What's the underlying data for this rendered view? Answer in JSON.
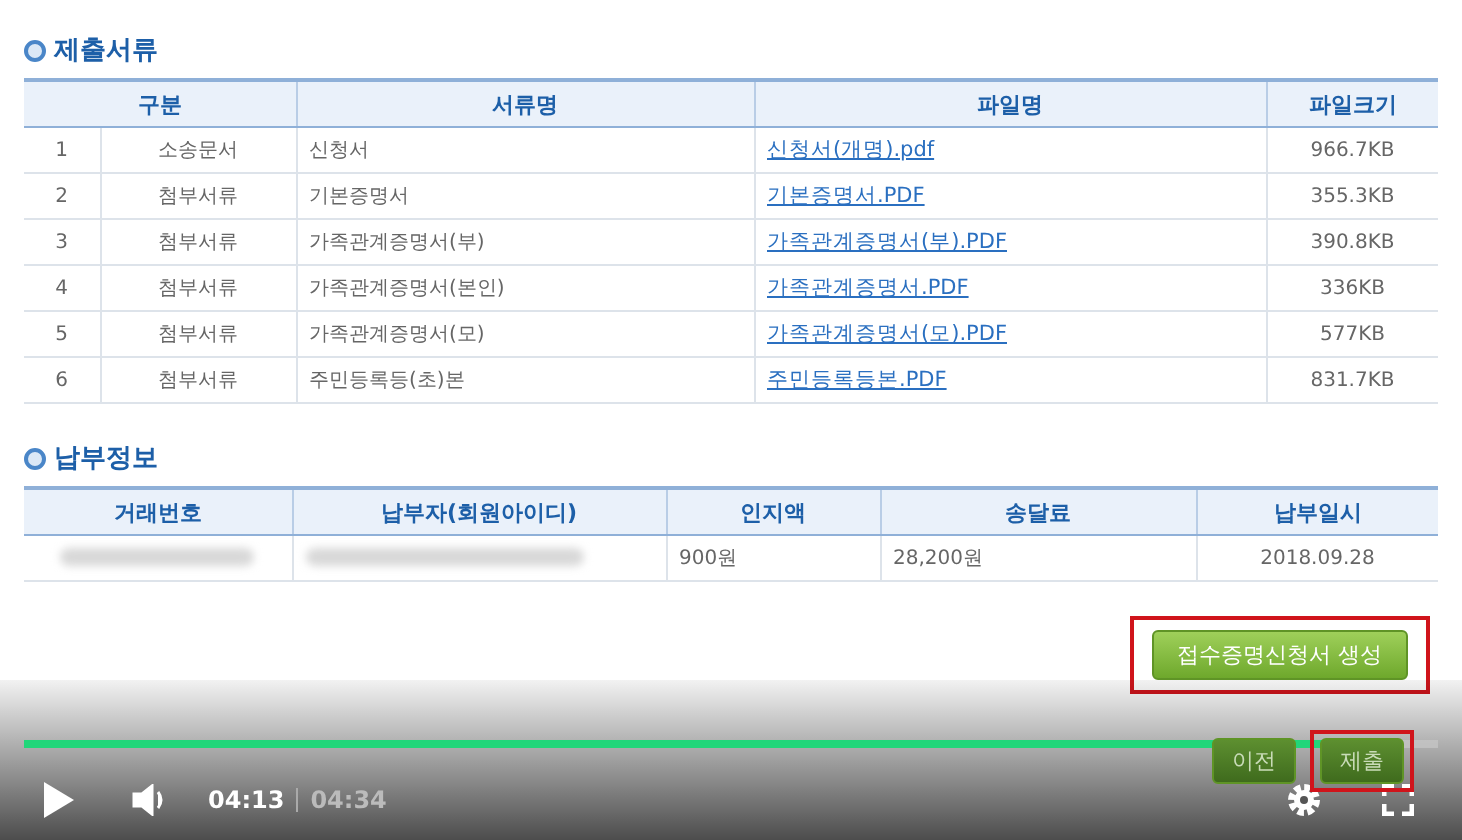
{
  "documents": {
    "title": "제출서류",
    "columns": [
      "구분",
      "서류명",
      "파일명",
      "파일크기"
    ],
    "rows": [
      {
        "no": "1",
        "type": "소송문서",
        "name": "신청서",
        "file": "신청서(개명).pdf",
        "size": "966.7KB"
      },
      {
        "no": "2",
        "type": "첨부서류",
        "name": "기본증명서",
        "file": "기본증명서.PDF",
        "size": "355.3KB"
      },
      {
        "no": "3",
        "type": "첨부서류",
        "name": "가족관계증명서(부)",
        "file": "가족관계증명서(부).PDF",
        "size": "390.8KB"
      },
      {
        "no": "4",
        "type": "첨부서류",
        "name": "가족관계증명서(본인)",
        "file": "가족관계증명서.PDF",
        "size": "336KB"
      },
      {
        "no": "5",
        "type": "첨부서류",
        "name": "가족관계증명서(모)",
        "file": "가족관계증명서(모).PDF",
        "size": "577KB"
      },
      {
        "no": "6",
        "type": "첨부서류",
        "name": "주민등록등(초)본",
        "file": "주민등록등본.PDF",
        "size": "831.7KB"
      }
    ]
  },
  "payment": {
    "title": "납부정보",
    "columns": [
      "거래번호",
      "납부자(회원아이디)",
      "인지액",
      "송달료",
      "납부일시"
    ],
    "rows": [
      {
        "cells": [
          {
            "blurred": true
          },
          {
            "blurred": true
          },
          {
            "text": "900원",
            "blurred": false
          },
          {
            "text": "28,200원",
            "blurred": false
          },
          {
            "text": "2018.09.28",
            "blurred": false
          }
        ]
      }
    ]
  },
  "generate_button": {
    "label": "접수증명신청서 생성",
    "highlighted": true
  },
  "prev_button": {
    "label": "이전"
  },
  "submit_button": {
    "label": "제출",
    "highlighted": true
  },
  "player": {
    "progress": {
      "level": 0.92
    },
    "current_time": "04:13",
    "duration": "04:34"
  }
}
